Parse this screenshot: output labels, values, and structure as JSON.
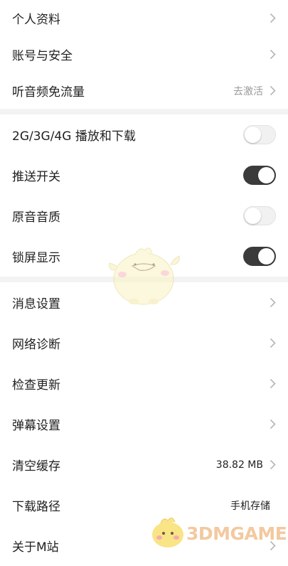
{
  "group1": [
    {
      "label": "个人资料"
    },
    {
      "label": "账号与安全"
    },
    {
      "label": "听音频免流量",
      "value": "去激活"
    }
  ],
  "group2": [
    {
      "label": "2G/3G/4G 播放和下载",
      "state": "off"
    },
    {
      "label": "推送开关",
      "state": "on"
    },
    {
      "label": "原音音质",
      "state": "off"
    },
    {
      "label": "锁屏显示",
      "state": "on"
    }
  ],
  "group3": [
    {
      "label": "消息设置"
    },
    {
      "label": "网络诊断"
    },
    {
      "label": "检查更新"
    },
    {
      "label": "弹幕设置"
    },
    {
      "label": "清空缓存",
      "value": "38.82 MB"
    },
    {
      "label": "下载路径",
      "value": "手机存储"
    },
    {
      "label": "关于M站"
    }
  ],
  "watermark": "3DMGAME",
  "colors": {
    "toggle_on": "#3b3b3b",
    "toggle_off": "#f1f1f1",
    "background": "#f3f3f4"
  },
  "icons": [
    "chevron-right-icon",
    "mascot-illustration",
    "watermark-mascot"
  ]
}
